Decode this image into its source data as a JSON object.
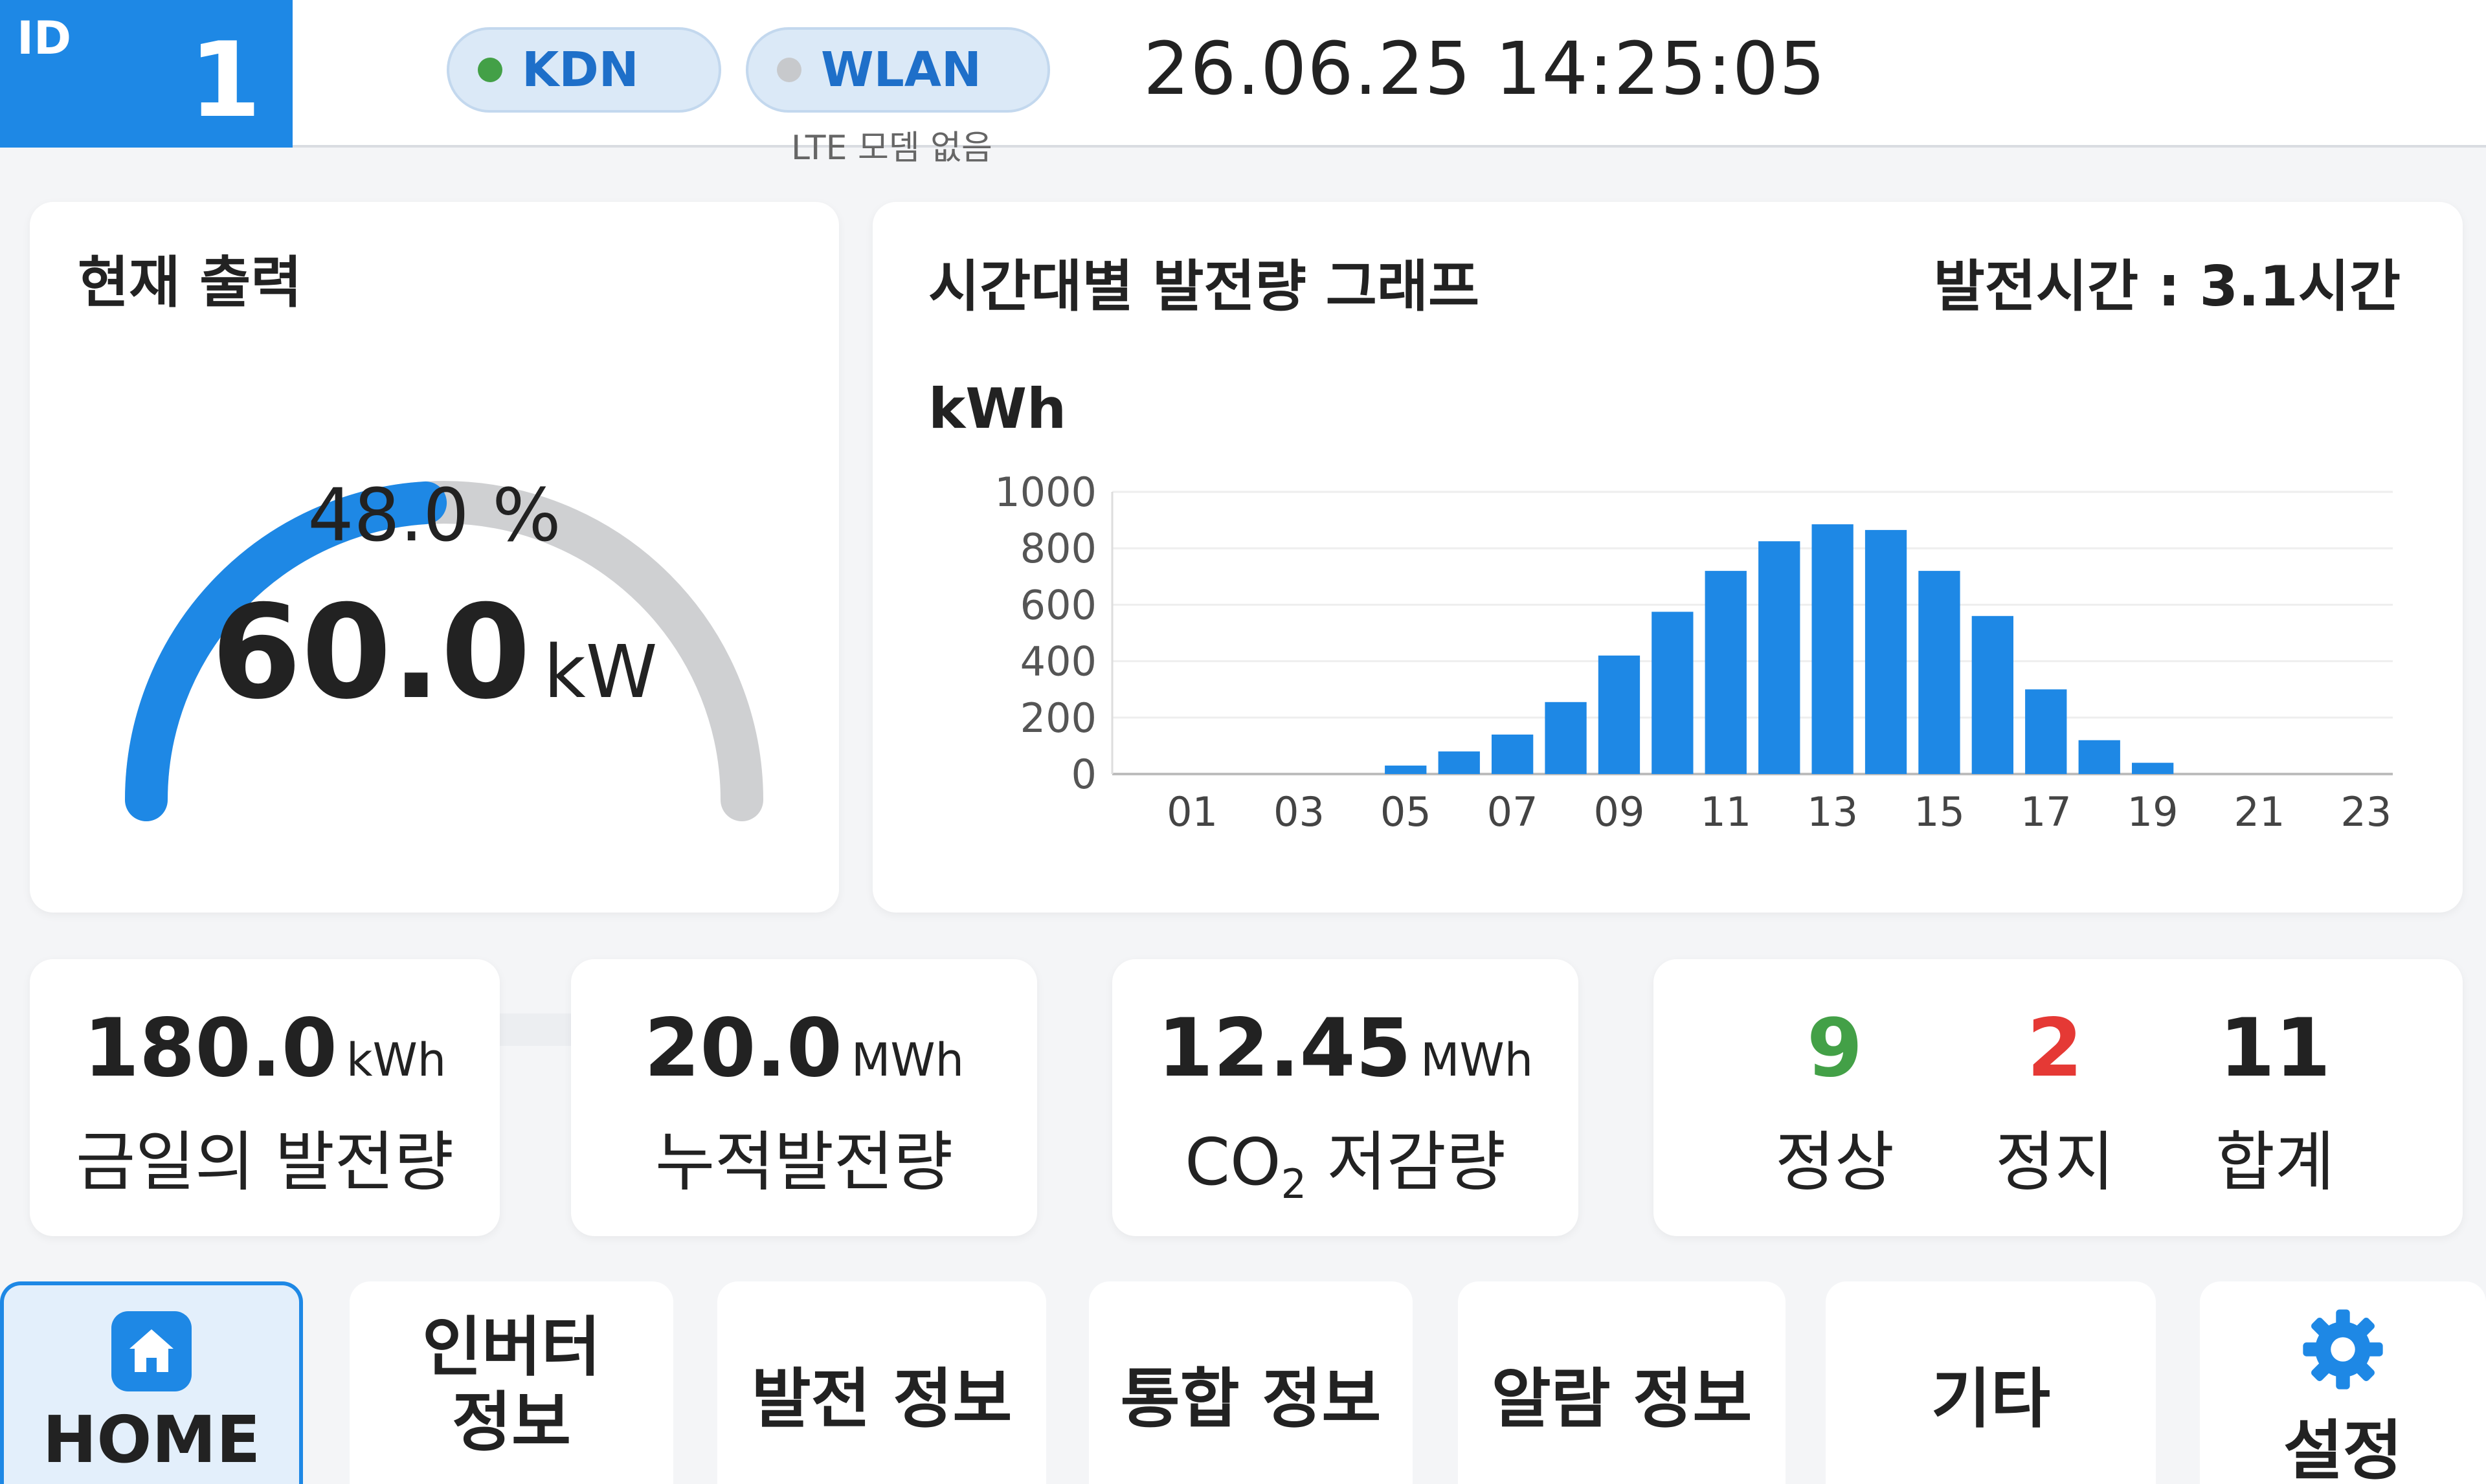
{
  "header": {
    "id_label": "ID",
    "id_value": "1",
    "status": [
      {
        "label": "KDN",
        "active": true,
        "color": "#43a047"
      },
      {
        "label": "WLAN",
        "active": false,
        "color": "#c7c9cc"
      }
    ],
    "lte_note": "LTE 모뎀 없음",
    "datetime": "26.06.25  14:25:05"
  },
  "gauge": {
    "title": "현재 출력",
    "percent_text": "48.0 %",
    "percent_value": 48.0,
    "power_value": "60.0",
    "power_unit": "kW",
    "progress_fraction": 0.48,
    "accent_color": "#1e88e5",
    "track_color": "#cfd0d2"
  },
  "chart_card": {
    "title": "시간대별 발전량 그래프",
    "generation_time": "발전시간 : 3.1시간",
    "unit_label": "kWh"
  },
  "chart_data": {
    "type": "bar",
    "ylabel": "kWh",
    "ylim": [
      0,
      1000
    ],
    "yticks": [
      "0",
      "200",
      "400",
      "600",
      "800",
      "1000"
    ],
    "ytick_values": [
      0,
      200,
      400,
      600,
      800,
      1000
    ],
    "x_tick_labels": [
      "01",
      "03",
      "05",
      "07",
      "09",
      "11",
      "13",
      "15",
      "17",
      "19",
      "21",
      "23"
    ],
    "categories": [
      "00",
      "01",
      "02",
      "03",
      "04",
      "05",
      "06",
      "07",
      "08",
      "09",
      "10",
      "11",
      "12",
      "13",
      "14",
      "15",
      "16",
      "17",
      "18",
      "19",
      "20",
      "21",
      "22",
      "23"
    ],
    "values": [
      0,
      0,
      0,
      0,
      0,
      30,
      80,
      140,
      255,
      420,
      575,
      720,
      825,
      885,
      865,
      720,
      560,
      300,
      120,
      40,
      0,
      0,
      0,
      0
    ],
    "bar_color": "#1e88e5",
    "grid": true
  },
  "stats": [
    {
      "value": "180.0",
      "unit": "kWh",
      "label": "금일의 발전량"
    },
    {
      "value": "20.0",
      "unit": "MWh",
      "label": "누적발전량"
    },
    {
      "value": "12.45",
      "unit": "MWh",
      "label_prefix": "CO",
      "label_sub": "2",
      "label_suffix": " 저감량"
    }
  ],
  "counts": [
    {
      "value": "9",
      "label": "정상",
      "color": "#43a047"
    },
    {
      "value": "2",
      "label": "정지",
      "color": "#e53935"
    },
    {
      "value": "11",
      "label": "합계",
      "color": "#222222"
    }
  ],
  "nav": {
    "home": "HOME",
    "inverter_line1": "인버터",
    "inverter_line2": "정보",
    "generation": "발전 정보",
    "integrated": "통합 정보",
    "alarm": "알람 정보",
    "etc": "기타",
    "settings": "설정",
    "home_icon": "home-icon",
    "settings_icon": "gear-icon"
  }
}
